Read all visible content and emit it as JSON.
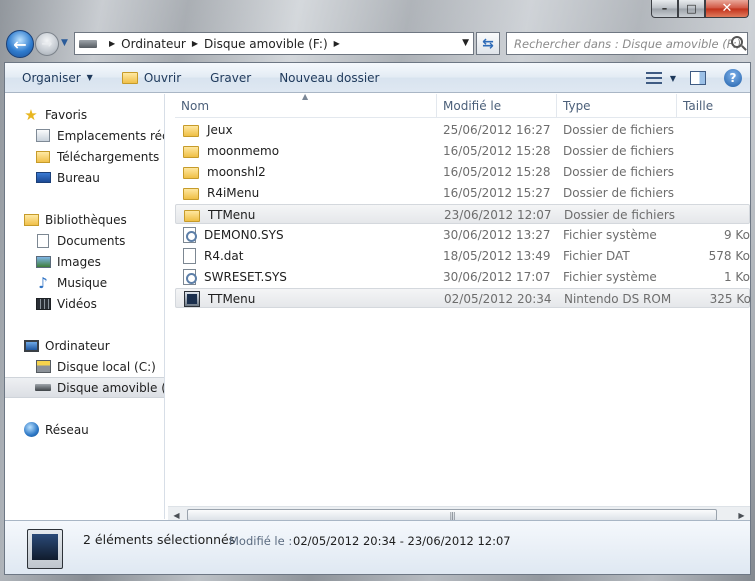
{
  "window": {
    "caption_buttons": [
      "minimize",
      "maximize",
      "close"
    ]
  },
  "navigation": {
    "breadcrumbs": [
      "Ordinateur",
      "Disque amovible (F:)"
    ],
    "search_placeholder": "Rechercher dans : Disque amovible (F:)"
  },
  "toolbar": {
    "organize": "Organiser",
    "open": "Ouvrir",
    "burn": "Graver",
    "new_folder": "Nouveau dossier"
  },
  "nav_pane": {
    "favorites_header": "Favoris",
    "favorites": [
      "Emplacements récents",
      "Téléchargements",
      "Bureau"
    ],
    "libraries_header": "Bibliothèques",
    "libraries": [
      "Documents",
      "Images",
      "Musique",
      "Vidéos"
    ],
    "computer_header": "Ordinateur",
    "computer": [
      "Disque local (C:)",
      "Disque amovible (F:)"
    ],
    "network_header": "Réseau"
  },
  "columns": {
    "name": "Nom",
    "modified": "Modifié le",
    "type": "Type",
    "size": "Taille"
  },
  "files": [
    {
      "name": "Jeux",
      "modified": "25/06/2012 16:27",
      "type": "Dossier de fichiers",
      "size": "",
      "icon": "folder-icon",
      "selected": false
    },
    {
      "name": "moonmemo",
      "modified": "16/05/2012 15:28",
      "type": "Dossier de fichiers",
      "size": "",
      "icon": "folder-icon",
      "selected": false
    },
    {
      "name": "moonshl2",
      "modified": "16/05/2012 15:28",
      "type": "Dossier de fichiers",
      "size": "",
      "icon": "folder-icon",
      "selected": false
    },
    {
      "name": "R4iMenu",
      "modified": "16/05/2012 15:27",
      "type": "Dossier de fichiers",
      "size": "",
      "icon": "folder-icon",
      "selected": false
    },
    {
      "name": "TTMenu",
      "modified": "23/06/2012 12:07",
      "type": "Dossier de fichiers",
      "size": "",
      "icon": "folder-icon",
      "selected": true
    },
    {
      "name": "DEMON0.SYS",
      "modified": "30/06/2012 13:27",
      "type": "Fichier système",
      "size": "9 Ko",
      "icon": "system-file-icon",
      "selected": false
    },
    {
      "name": "R4.dat",
      "modified": "18/05/2012 13:49",
      "type": "Fichier DAT",
      "size": "578 Ko",
      "icon": "dat-file-icon",
      "selected": false
    },
    {
      "name": "SWRESET.SYS",
      "modified": "30/06/2012 17:07",
      "type": "Fichier système",
      "size": "1 Ko",
      "icon": "system-file-icon",
      "selected": false
    },
    {
      "name": "TTMenu",
      "modified": "02/05/2012 20:34",
      "type": "Nintendo DS ROM",
      "size": "325 Ko",
      "icon": "nds-rom-icon",
      "selected": true
    }
  ],
  "details": {
    "count": "2 éléments sélectionnés",
    "modified_label": "Modifié le :",
    "modified_value": "02/05/2012 20:34 - 23/06/2012 12:07"
  }
}
